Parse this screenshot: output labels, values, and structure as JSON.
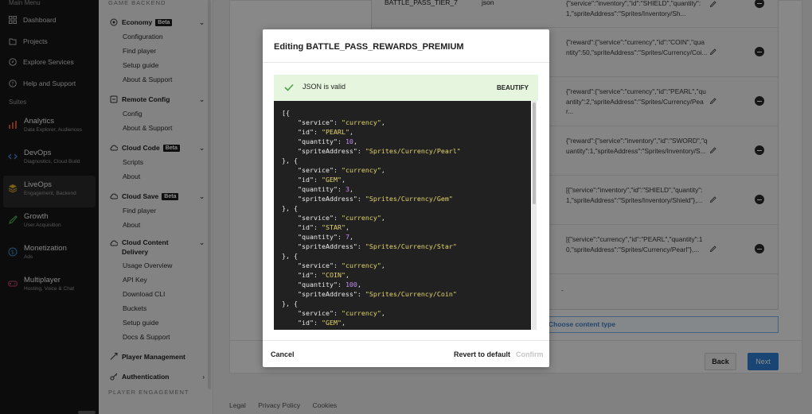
{
  "leftnav": {
    "header": "Main Menu",
    "items": [
      {
        "label": "Dashboard",
        "icon": "grid-icon"
      },
      {
        "label": "Projects",
        "icon": "folder-icon"
      },
      {
        "label": "Explore Services",
        "icon": "compass-icon"
      },
      {
        "label": "Help and Support",
        "icon": "help-icon"
      }
    ],
    "suites_label": "Suites",
    "suites": [
      {
        "title": "Analytics",
        "subtitle": "Data Explorer, Audiences",
        "icon": "chart-icon",
        "color": "#e0572f"
      },
      {
        "title": "DevOps",
        "subtitle": "Diagnostics, Cloud Build",
        "icon": "code-icon",
        "color": "#4a8cdb"
      },
      {
        "title": "LiveOps",
        "subtitle": "Engagement, Backend",
        "icon": "layers-icon",
        "color": "#e0b030"
      },
      {
        "title": "Growth",
        "subtitle": "User Acquisition",
        "icon": "rocket-icon",
        "color": "#4caf50"
      },
      {
        "title": "Monetization",
        "subtitle": "Ads",
        "icon": "dollar-icon",
        "color": "#3c8fd8"
      },
      {
        "title": "Multiplayer",
        "subtitle": "Hosting, Voice & Chat",
        "icon": "gamepad-icon",
        "color": "#d84f7a"
      }
    ]
  },
  "subnav": {
    "header": "GAME BACKEND",
    "sections": [
      {
        "label": "Economy",
        "badge": "Beta",
        "icon": "economy-icon",
        "children": [
          "Configuration",
          "Find player",
          "Setup guide",
          "About & Support"
        ]
      },
      {
        "label": "Remote Config",
        "badge": "",
        "icon": "remote-config-icon",
        "children": [
          "Config",
          "About & Support"
        ]
      },
      {
        "label": "Cloud Code",
        "badge": "Beta",
        "icon": "cloud-code-icon",
        "children": [
          "Scripts",
          "About"
        ]
      },
      {
        "label": "Cloud Save",
        "badge": "Beta",
        "icon": "cloud-save-icon",
        "children": [
          "Find player",
          "About"
        ]
      },
      {
        "label": "Cloud Content Delivery",
        "label_line1": "Cloud Content",
        "label_line2": "Delivery",
        "badge": "",
        "icon": "ccd-icon",
        "children": [
          "Usage Overview",
          "API Key",
          "Download CLI",
          "Buckets",
          "Setup guide",
          "Docs & Support"
        ]
      },
      {
        "label": "Player Management",
        "badge": "",
        "icon": "player-mgmt-icon",
        "children": []
      },
      {
        "label": "Authentication",
        "badge": "",
        "icon": "key-icon",
        "children": []
      }
    ],
    "footer_header": "PLAYER ENGAGEMENT"
  },
  "table": {
    "rows": [
      {
        "name": "BATTLE_PASS_TIER_7",
        "type": "json",
        "value": "{\"service\":\"inventory\",\"id\":\"SHIELD\",\"quantity\":1,\"spriteAddress\":\"Sprites/Inventory/Sh..."
      },
      {
        "name": "",
        "type": "",
        "value": "{\"reward\":{\"service\":\"currency\",\"id\":\"COIN\",\"quantity\":50,\"spriteAddress\":\"Sprites/Currency/Coi..."
      },
      {
        "name": "",
        "type": "",
        "value": "{\"reward\":{\"service\":\"currency\",\"id\":\"PEARL\",\"quantity\":2,\"spriteAddress\":\"Sprites/Currency/Pear..."
      },
      {
        "name": "",
        "type": "",
        "value": "{\"reward\":{\"service\":\"inventory\",\"id\":\"SWORD\",\"quantity\":1,\"spriteAddress\":\"Sprites/Inventory/S..."
      },
      {
        "name": "",
        "type": "",
        "value": "[{\"service\":\"inventory\",\"id\":\"SHIELD\",\"quantity\":1,\"spriteAddress\":\"Sprites/Inventory/Shield\"},..."
      },
      {
        "name": "",
        "type": "",
        "value": "[{\"service\":\"currency\",\"id\":\"PEARL\",\"quantity\":10,\"spriteAddress\":\"Sprites/Currency/Pearl\"},..."
      },
      {
        "name": "",
        "type": "",
        "value": "-"
      }
    ],
    "choose_label": "Choose content type"
  },
  "actions": {
    "back": "Back",
    "next": "Next"
  },
  "footer": {
    "links": [
      "Legal",
      "Privacy Policy",
      "Cookies"
    ]
  },
  "modal": {
    "title": "Editing BATTLE_PASS_REWARDS_PREMIUM",
    "valid_text": "JSON is valid",
    "beautify": "BEAUTIFY",
    "cancel": "Cancel",
    "revert": "Revert to default",
    "confirm": "Confirm",
    "json_items": [
      {
        "service": "currency",
        "id": "PEARL",
        "quantity": 10,
        "spriteAddress": "Sprites/Currency/Pearl"
      },
      {
        "service": "currency",
        "id": "GEM",
        "quantity": 3,
        "spriteAddress": "Sprites/Currency/Gem"
      },
      {
        "service": "currency",
        "id": "STAR",
        "quantity": 7,
        "spriteAddress": "Sprites/Currency/Star"
      },
      {
        "service": "currency",
        "id": "COIN",
        "quantity": 100,
        "spriteAddress": "Sprites/Currency/Coin"
      },
      {
        "service": "currency",
        "id": "GEM",
        "quantity": null,
        "spriteAddress": null
      }
    ]
  },
  "colors": {
    "accent": "#2f7fd6",
    "valid_bg": "#e6f5de",
    "editor_bg": "#212121",
    "string": "#e3d46e",
    "number": "#c58af0"
  }
}
